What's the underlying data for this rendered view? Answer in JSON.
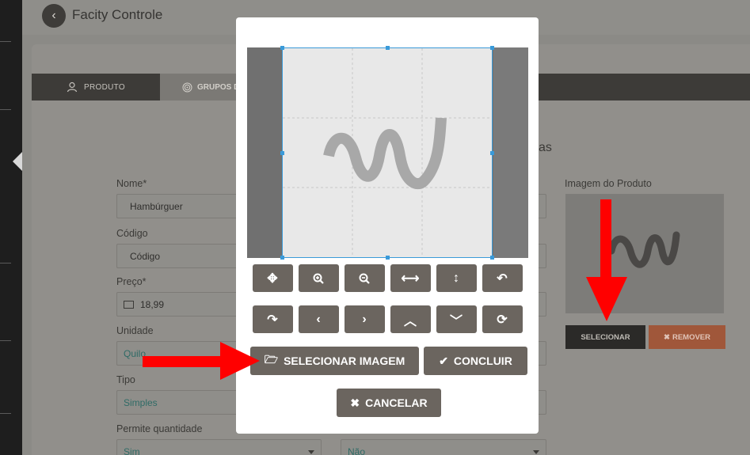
{
  "header": {
    "title": "Facity Controle"
  },
  "tabs": [
    {
      "label": "PRODUTO"
    },
    {
      "label": "GRUPOS D"
    }
  ],
  "form": {
    "nome_label": "Nome*",
    "nome_value": "Hambúrguer",
    "codigo_label": "Código",
    "codigo_value": "Código",
    "preco_label": "Preço*",
    "preco_value": "18,99",
    "unidade_label": "Unidade",
    "unidade_value": "Quilo",
    "tipo_label": "Tipo",
    "tipo_value": "Simples",
    "permite_label": "Permite quantidade",
    "permite_value": "Sim",
    "right_select_value": "Não",
    "partial_text": "as"
  },
  "product_image": {
    "label": "Imagem do Produto",
    "select_label": "SELECIONAR",
    "remove_label": "REMOVER"
  },
  "modal": {
    "select_image_label": "SELECIONAR IMAGEM",
    "finish_label": "CONCLUIR",
    "cancel_label": "CANCELAR",
    "toolbar_row1": [
      "move-icon",
      "zoom-in-icon",
      "zoom-out-icon",
      "flip-horizontal-icon",
      "flip-vertical-icon",
      "rotate-left-icon"
    ],
    "toolbar_row2": [
      "rotate-right-icon",
      "chevron-left-icon",
      "chevron-right-icon",
      "chevron-up-icon",
      "chevron-down-icon",
      "reset-icon"
    ]
  },
  "colors": {
    "annotation_arrow": "#ff0000",
    "crop_border": "#3a9ad9",
    "button_bg": "#6b655f",
    "remove_button": "#a0573a"
  }
}
